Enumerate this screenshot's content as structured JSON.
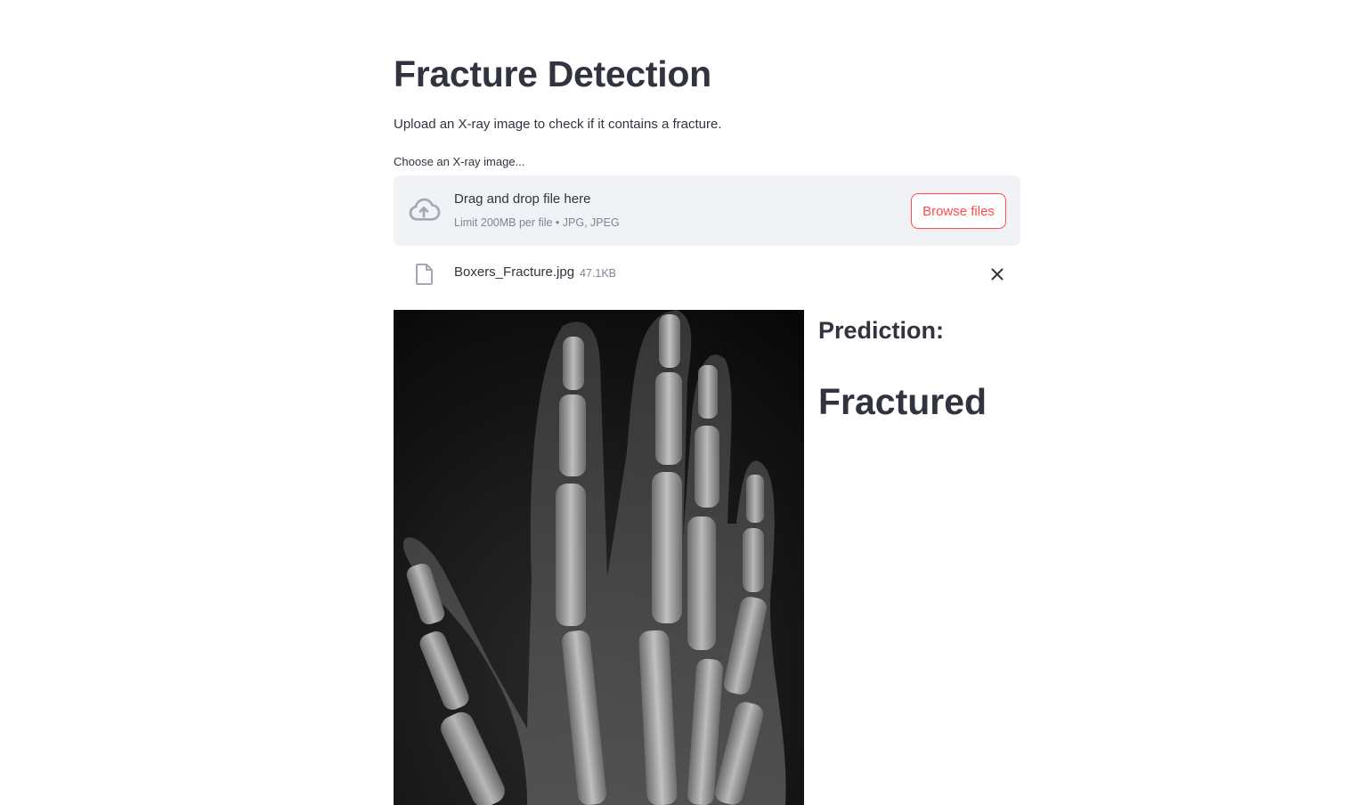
{
  "page": {
    "title": "Fracture Detection",
    "subtitle": "Upload an X-ray image to check if it contains a fracture."
  },
  "uploader": {
    "label": "Choose an X-ray image...",
    "drop_text": "Drag and drop file here",
    "limit_text": "Limit 200MB per file • JPG, JPEG",
    "browse_label": "Browse files",
    "icon": "cloud-upload-icon"
  },
  "uploaded_file": {
    "name": "Boxers_Fracture.jpg",
    "size": "47.1KB",
    "icon": "file-icon",
    "remove_icon": "close-icon"
  },
  "result": {
    "label": "Prediction:",
    "value": "Fractured"
  },
  "colors": {
    "text": "#31333f",
    "muted": "#808495",
    "accent": "#ff4b4b",
    "dropzone_bg": "#f0f2f6",
    "icon": "#a3a8b8"
  }
}
